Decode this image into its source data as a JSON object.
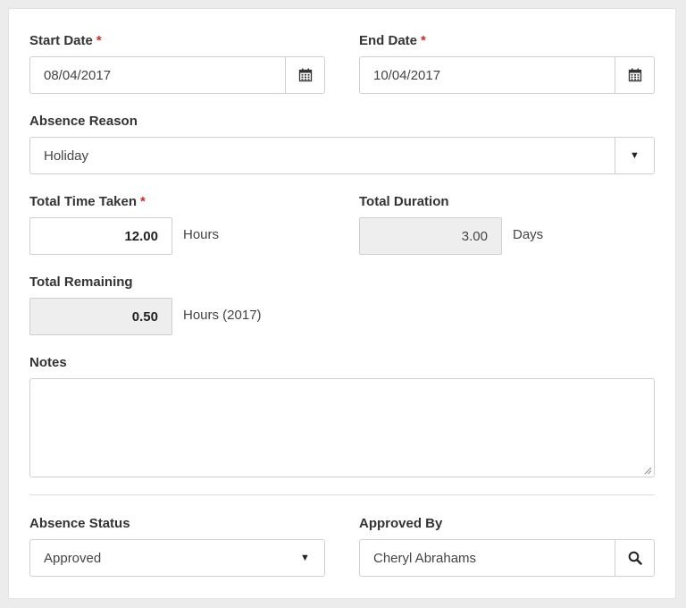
{
  "form": {
    "start_date": {
      "label": "Start Date",
      "required": "*",
      "value": "08/04/2017",
      "icon": "calendar-icon"
    },
    "end_date": {
      "label": "End Date",
      "required": "*",
      "value": "10/04/2017",
      "icon": "calendar-icon"
    },
    "absence_reason": {
      "label": "Absence Reason",
      "value": "Holiday",
      "icon": "caret-down-icon"
    },
    "total_time_taken": {
      "label": "Total Time Taken",
      "required": "*",
      "value": "12.00",
      "unit": "Hours"
    },
    "total_duration": {
      "label": "Total Duration",
      "value": "3.00",
      "unit": "Days"
    },
    "total_remaining": {
      "label": "Total Remaining",
      "value": "0.50",
      "unit": "Hours (2017)"
    },
    "notes": {
      "label": "Notes",
      "value": ""
    },
    "absence_status": {
      "label": "Absence Status",
      "value": "Approved",
      "icon": "caret-down-icon"
    },
    "approved_by": {
      "label": "Approved By",
      "value": "Cheryl Abrahams",
      "icon": "search-icon"
    }
  },
  "colors": {
    "required": "#c9302c",
    "readonly_bg": "#eeeeee",
    "border": "#cfcfcf"
  }
}
